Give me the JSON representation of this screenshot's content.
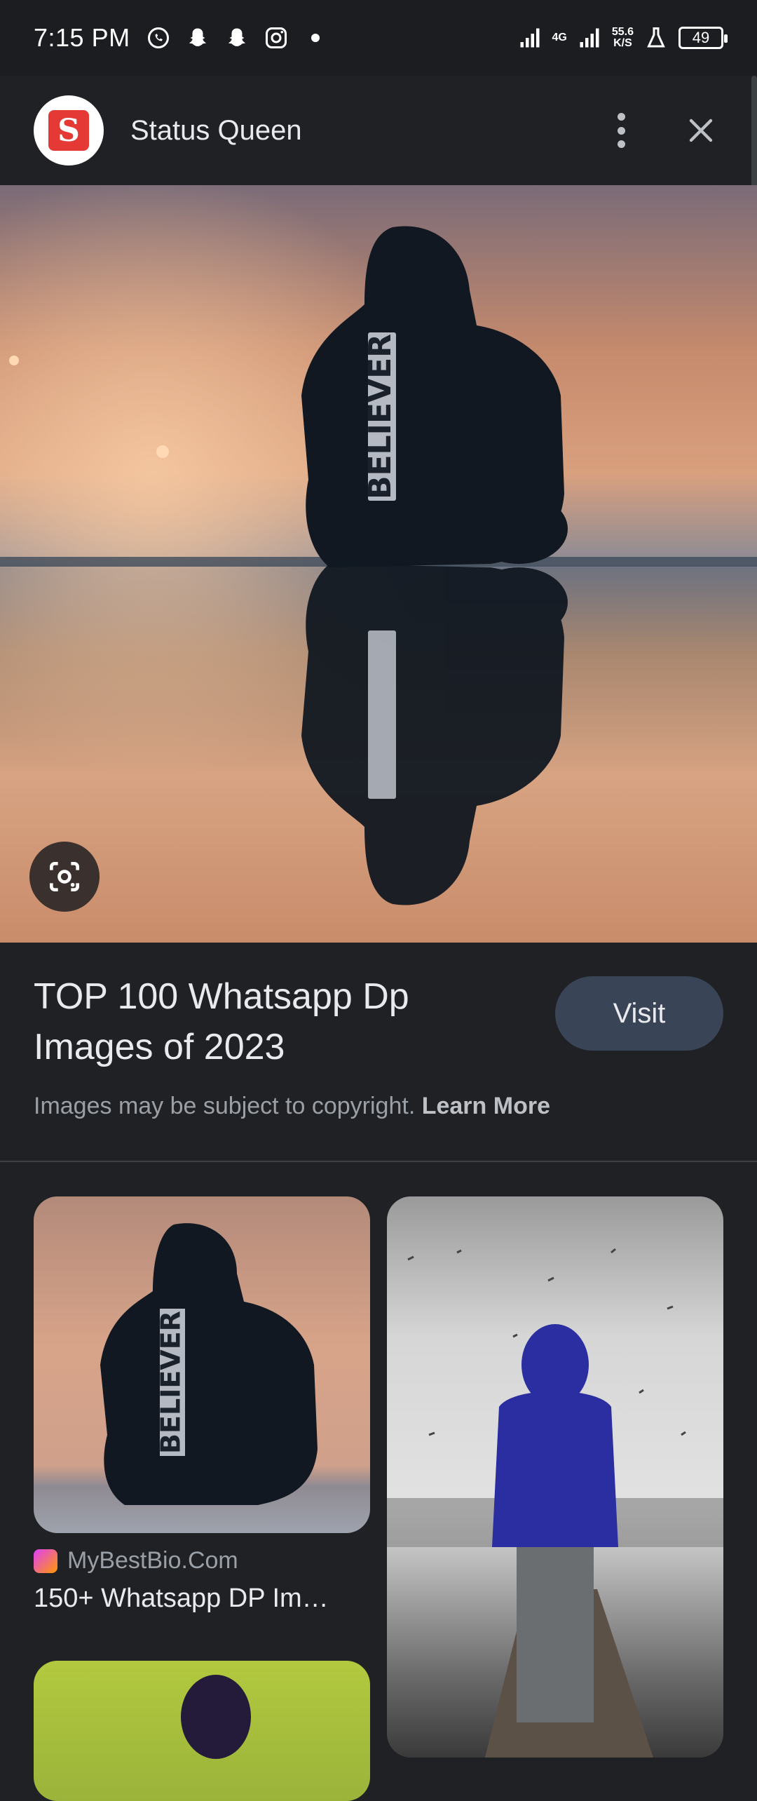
{
  "status_bar": {
    "time": "7:15 PM",
    "network_speed_value": "55.6",
    "network_speed_unit": "K/S",
    "network_type": "4G",
    "battery": "49",
    "icons": [
      "whatsapp-icon",
      "snapchat-icon",
      "snapchat-icon",
      "instagram-icon",
      "dot-icon",
      "signal-icon",
      "signal-4g-icon",
      "lab-icon",
      "battery-icon"
    ]
  },
  "header": {
    "site_name": "Status Queen",
    "logo_letter": "S"
  },
  "hero": {
    "jacket_text": "BELIEVER"
  },
  "info": {
    "title": "TOP 100 Whatsapp Dp Images of 2023",
    "visit_label": "Visit",
    "copyright_text": "Images may be subject to copyright.",
    "learn_more": "Learn More"
  },
  "related": [
    {
      "source": "MyBestBio.Com",
      "caption": "150+ Whatsapp DP Im…",
      "jacket_text": "BELIEVER"
    }
  ],
  "colors": {
    "background": "#202124",
    "visit_button": "#394457",
    "logo_red": "#e53935"
  }
}
